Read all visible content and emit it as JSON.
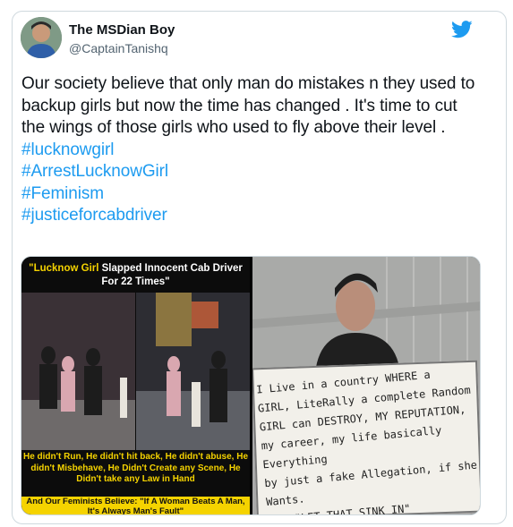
{
  "author": {
    "display_name": "The MSDian Boy",
    "handle": "@CaptainTanishq"
  },
  "tweet": {
    "text": "Our society believe that only man do mistakes n they used to backup girls but now the time has changed . It's time to cut the wings of those girls who used to fly above their level .",
    "hashtags": [
      "#lucknowgirl",
      "#ArrestLucknowGirl",
      "#Feminism",
      "#justiceforcabdriver"
    ]
  },
  "media": {
    "left_panel": {
      "title_highlight": "\"Lucknow Girl",
      "title_rest": " Slapped Innocent Cab Driver For 22 Times\"",
      "caption": "He didn't Run, He didn't hit back, He didn't abuse, He didn't Misbehave, He Didn't Create any Scene, He Didn't take any Law in Hand",
      "quote": "And Our Feminists Believe: \"If A Woman Beats A Man, It's Always Man's Fault\""
    },
    "right_panel": {
      "sign_lines": [
        "I Live in a country WHERE a",
        "GIRL, LiteRally a complete Random",
        "GIRL can DESTROY, MY REPUTATION,",
        "my career, my life basically Everything",
        "by just a fake Allegation, if she Wants.",
        "\"LET THAT SINK IN\""
      ]
    }
  },
  "colors": {
    "link": "#1d9bf0",
    "text": "#0f1419",
    "secondary": "#536471",
    "highlight_yellow": "#f5d300"
  },
  "icons": [
    "twitter-bird-icon",
    "avatar"
  ]
}
